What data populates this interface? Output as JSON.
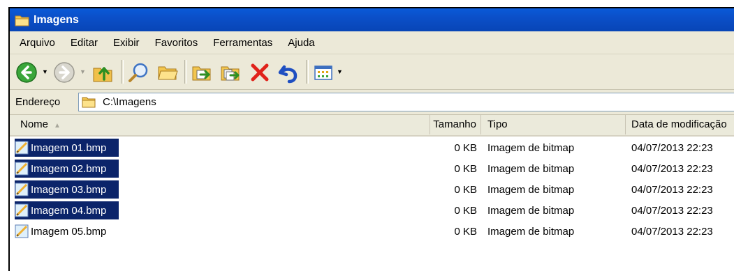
{
  "window": {
    "title": "Imagens"
  },
  "menu": [
    "Arquivo",
    "Editar",
    "Exibir",
    "Favoritos",
    "Ferramentas",
    "Ajuda"
  ],
  "toolbar": {
    "icons": [
      "back-icon",
      "forward-icon",
      "up-folder-icon",
      "search-icon",
      "folders-icon",
      "move-to-icon",
      "copy-to-icon",
      "delete-icon",
      "undo-icon",
      "views-icon"
    ]
  },
  "address": {
    "label": "Endereço",
    "path": "C:\\Imagens"
  },
  "columns": {
    "name": "Nome",
    "size": "Tamanho",
    "type": "Tipo",
    "date": "Data de modificação"
  },
  "files": [
    {
      "name": "Imagem 01.bmp",
      "size": "0 KB",
      "type": "Imagem de bitmap",
      "date": "04/07/2013 22:23",
      "selected": true
    },
    {
      "name": "Imagem 02.bmp",
      "size": "0 KB",
      "type": "Imagem de bitmap",
      "date": "04/07/2013 22:23",
      "selected": true
    },
    {
      "name": "Imagem 03.bmp",
      "size": "0 KB",
      "type": "Imagem de bitmap",
      "date": "04/07/2013 22:23",
      "selected": true
    },
    {
      "name": "Imagem 04.bmp",
      "size": "0 KB",
      "type": "Imagem de bitmap",
      "date": "04/07/2013 22:23",
      "selected": true
    },
    {
      "name": "Imagem 05.bmp",
      "size": "0 KB",
      "type": "Imagem de bitmap",
      "date": "04/07/2013 22:23",
      "selected": false
    }
  ],
  "colors": {
    "titlebar": "#0b4fc8",
    "selection": "#0b246a",
    "chrome": "#ece9d8"
  }
}
